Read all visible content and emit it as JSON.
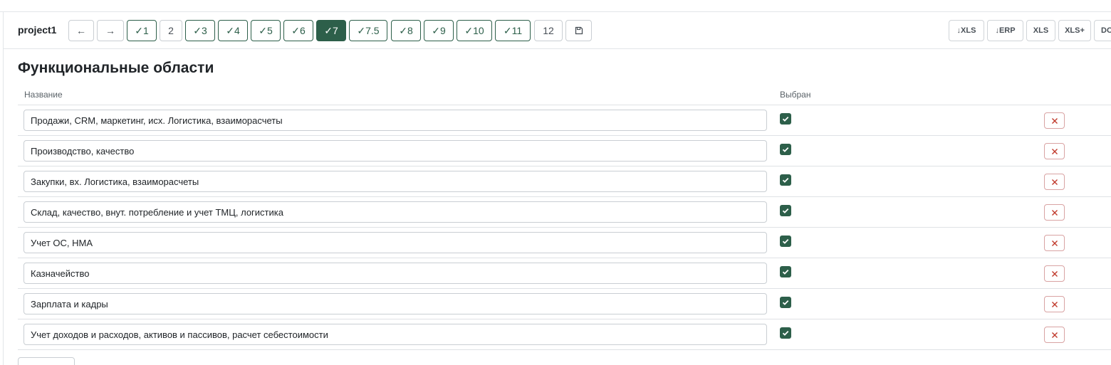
{
  "toolbar": {
    "project": "project1",
    "back": "←",
    "forward": "→",
    "steps": [
      {
        "label": "✓1",
        "state": "done"
      },
      {
        "label": "2",
        "state": "todo"
      },
      {
        "label": "✓3",
        "state": "done"
      },
      {
        "label": "✓4",
        "state": "done"
      },
      {
        "label": "✓5",
        "state": "done"
      },
      {
        "label": "✓6",
        "state": "done"
      },
      {
        "label": "✓7",
        "state": "active"
      },
      {
        "label": "✓7.5",
        "state": "done"
      },
      {
        "label": "✓8",
        "state": "done"
      },
      {
        "label": "✓9",
        "state": "done"
      },
      {
        "label": "✓10",
        "state": "done"
      },
      {
        "label": "✓11",
        "state": "done"
      },
      {
        "label": "12",
        "state": "todo"
      }
    ],
    "save_icon": "save-icon",
    "exports": [
      "↓XLS",
      "↓ERP",
      "XLS",
      "XLS+",
      "DO"
    ]
  },
  "section": {
    "title": "Функциональные области",
    "col_name": "Название",
    "col_selected": "Выбран"
  },
  "rows": [
    {
      "name": "Продажи, CRM, маркетинг, исх. Логистика, взаиморасчеты",
      "selected": true
    },
    {
      "name": "Производство, качество",
      "selected": true
    },
    {
      "name": "Закупки, вх. Логистика, взаиморасчеты",
      "selected": true
    },
    {
      "name": "Склад, качество, внут. потребление и учет ТМЦ, логистика",
      "selected": true
    },
    {
      "name": "Учет ОС, НМА",
      "selected": true
    },
    {
      "name": "Казначейство",
      "selected": true
    },
    {
      "name": "Зарплата и кадры",
      "selected": true
    },
    {
      "name": "Учет доходов и расходов, активов и пассивов, расчет себестоимости",
      "selected": true
    }
  ],
  "colors": {
    "accent": "#2d5f4a",
    "danger": "#c0392b"
  }
}
